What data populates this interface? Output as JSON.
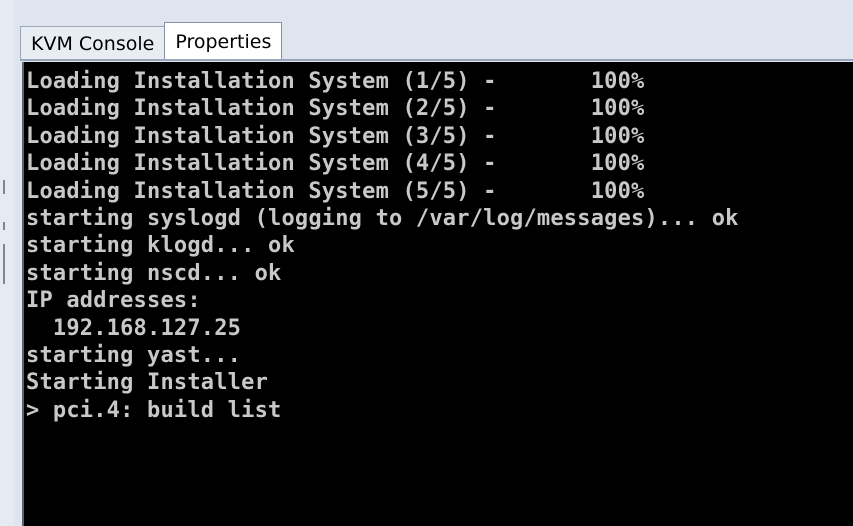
{
  "tabs": [
    {
      "label": "KVM Console",
      "active": false
    },
    {
      "label": "Properties",
      "active": true
    }
  ],
  "console": {
    "background": "#000000",
    "text_color": "#c8c8c8",
    "lines": [
      "Loading Installation System (1/5) -       100%",
      "Loading Installation System (2/5) -       100%",
      "Loading Installation System (3/5) -       100%",
      "Loading Installation System (4/5) -       100%",
      "Loading Installation System (5/5) -       100%",
      "starting syslogd (logging to /var/log/messages)... ok",
      "starting klogd... ok",
      "starting nscd... ok",
      "IP addresses:",
      "  192.168.127.25",
      "starting yast...",
      "Starting Installer",
      "> pci.4: build list"
    ]
  }
}
